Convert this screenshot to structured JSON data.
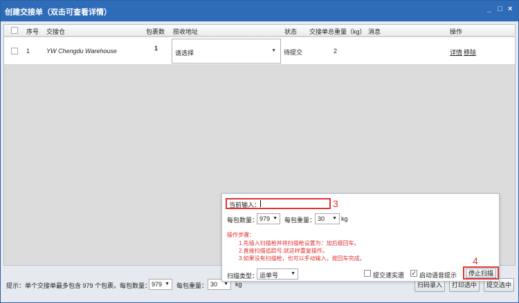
{
  "window": {
    "title": "创建交接单（双击可查看详情）",
    "controls": [
      "_",
      "□",
      "×"
    ]
  },
  "grid": {
    "headers": {
      "seq": "序号",
      "warehouse": "交接仓",
      "packages": "包裹数",
      "address": "揽收地址",
      "status": "状态",
      "weight": "交接单总重量（kg）",
      "message": "消息",
      "action": "操作"
    },
    "rows": [
      {
        "seq": "1",
        "warehouse": "YW Chengdu Warehouse",
        "packages": "1",
        "address": "请选择",
        "status": "待提交",
        "weight": "2",
        "detail": "详情",
        "remove": "移除"
      }
    ]
  },
  "bottom": {
    "hint": "提示：单个交接单最多包含 979 个包裹。每包数量：",
    "count_value": "979",
    "weight_label": "每包重量：",
    "weight_value": "30",
    "unit": "kg",
    "btn_scan_input": "扫码录入",
    "btn_print": "打印选中",
    "btn_submit": "提交选中"
  },
  "panel": {
    "current_input_label": "当前输入：",
    "count_label": "每包数量：",
    "count_value": "979",
    "weight_label": "每包重量：",
    "weight_value": "30",
    "unit": "kg",
    "steps_title": "操作步骤：",
    "steps": [
      "1.先插入扫描枪并将扫描枪设置为：加后缀回车。",
      "2.直接扫描追踪号,就这样重复操作。",
      "3.如果没有扫描枪，也可以手动输入，按回车完成。"
    ],
    "scan_type_label": "扫描类型：",
    "scan_type_value": "运单号",
    "quick_submit_label": "提交速实遗",
    "voice_label": "启动语音提示",
    "stop_scan_label": "停止扫描"
  },
  "annotations": {
    "n3": "3",
    "n4": "4"
  },
  "colors": {
    "titlebar": "#2e6bb8",
    "highlight": "#e03030",
    "link": "#1a5fb4"
  }
}
